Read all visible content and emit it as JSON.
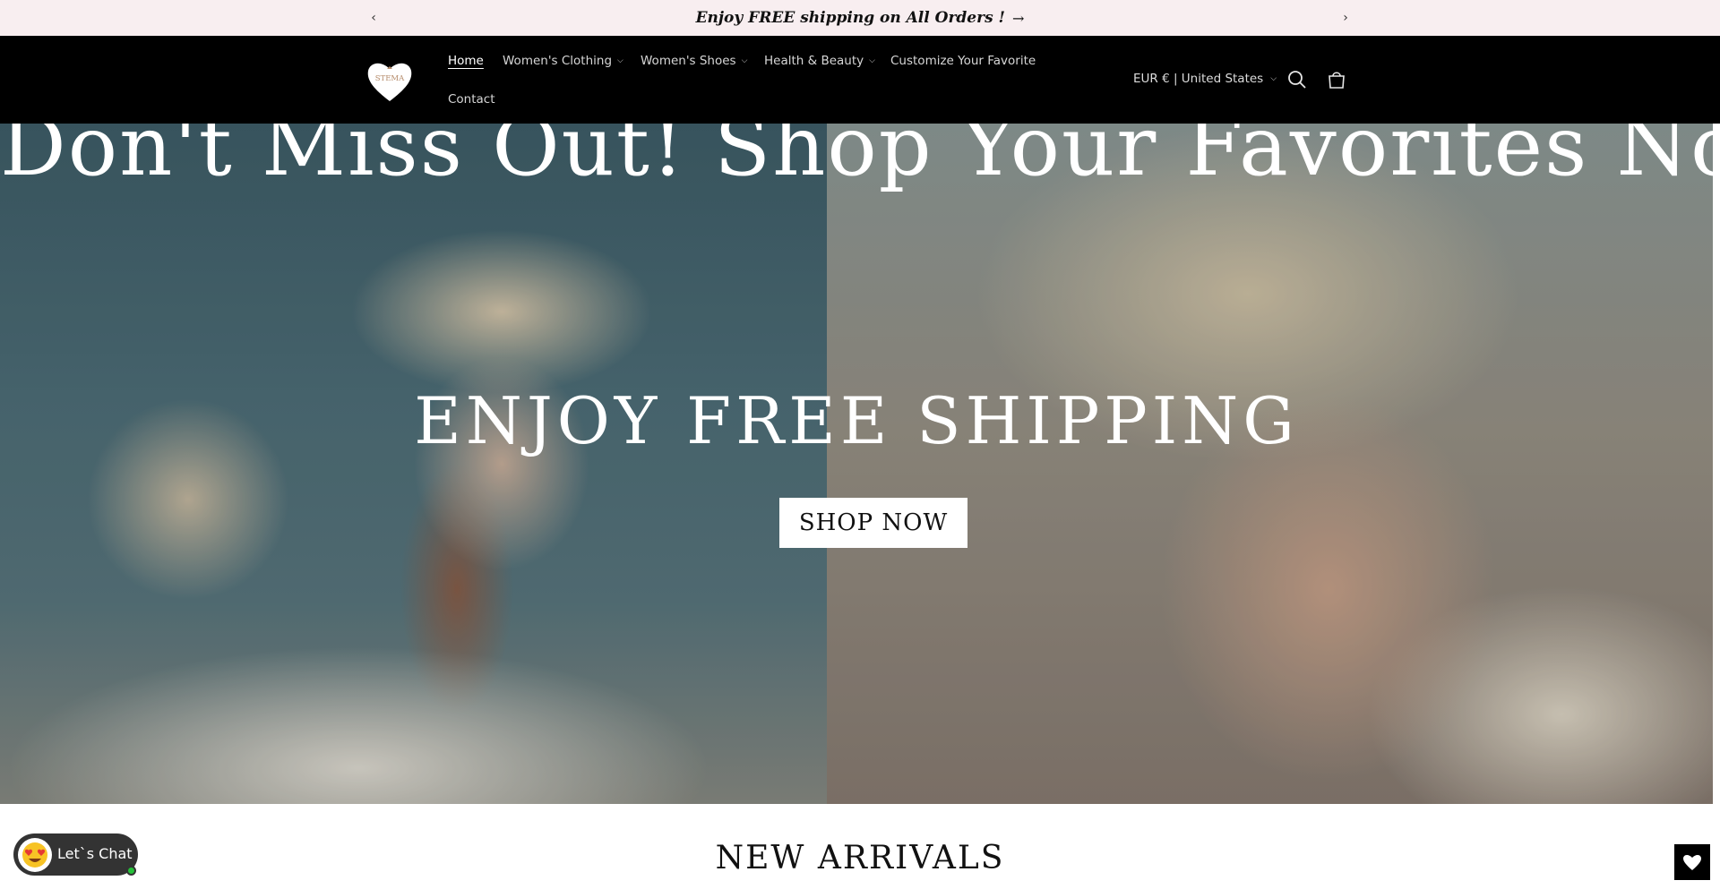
{
  "announcement": {
    "text": "Enjoy FREE shipping on All Orders !",
    "prev_icon": "chevron-left-icon",
    "next_icon": "chevron-right-icon"
  },
  "header": {
    "logo_text": "STEMA",
    "nav": [
      {
        "label": "Home",
        "active": true,
        "dropdown": false
      },
      {
        "label": "Women's Clothing",
        "dropdown": true
      },
      {
        "label": "Women's Shoes",
        "dropdown": true
      },
      {
        "label": "Health & Beauty",
        "dropdown": true
      },
      {
        "label": "Customize Your Favorite",
        "dropdown": false
      },
      {
        "label": "Contact",
        "dropdown": false
      }
    ],
    "country_selector": "EUR € | United States",
    "icons": [
      "search-icon",
      "cart-icon"
    ]
  },
  "hero": {
    "banner_text": "Don't Miss Out! Shop Your Favorites Now!",
    "headline": "ENJOY FREE SHIPPING",
    "cta": "SHOP NOW"
  },
  "section": {
    "title": "NEW ARRIVALS"
  },
  "chat": {
    "label": "Let`s Chat",
    "icon": "heart-eyes-emoji-icon"
  },
  "wishlist": {
    "icon": "heart-icon"
  },
  "colors": {
    "announcement_bg": "#f8eef0",
    "header_bg": "#000000",
    "chat_bg": "#333333",
    "online_dot": "#25c13a"
  }
}
